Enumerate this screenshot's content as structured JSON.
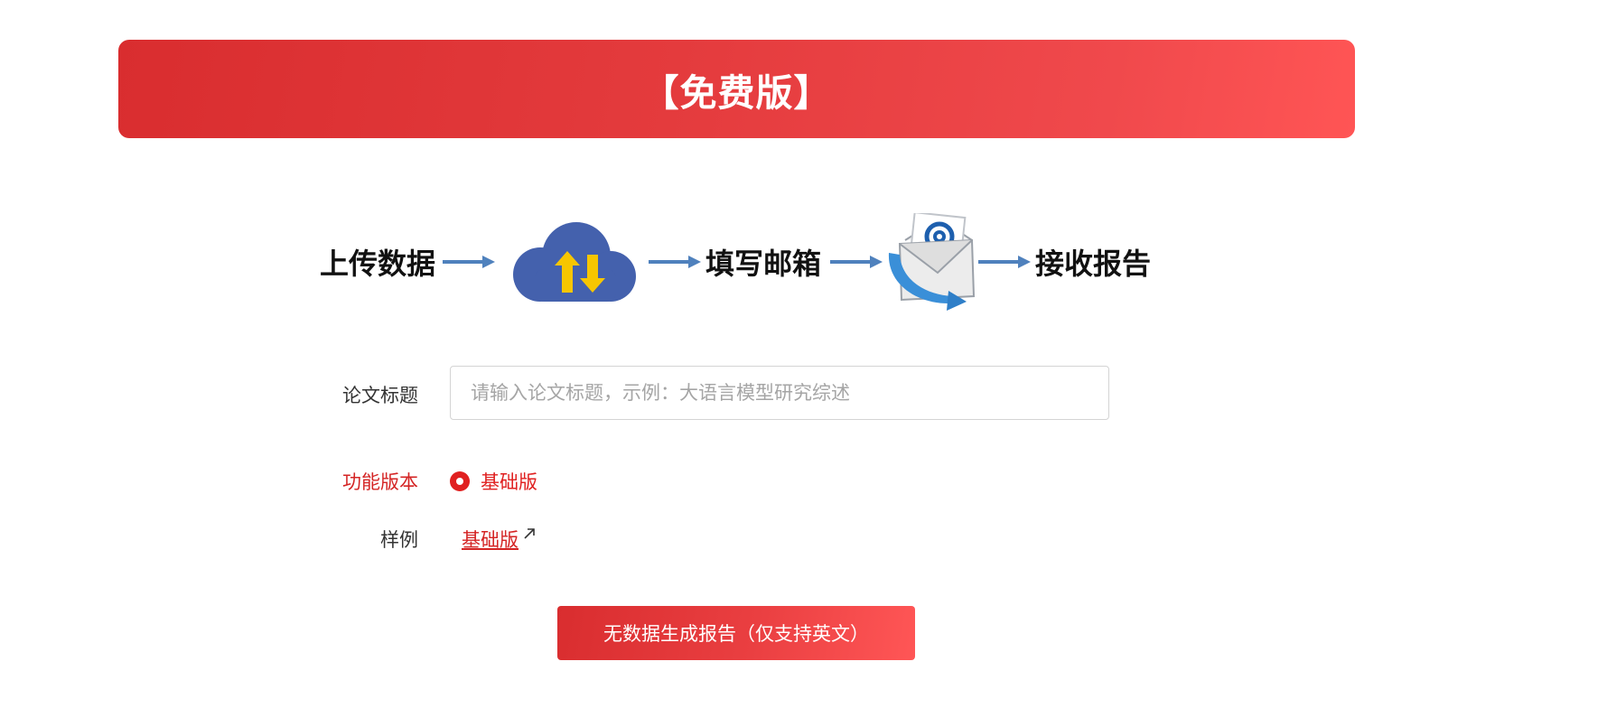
{
  "banner": {
    "title": "【免费版】"
  },
  "flow": {
    "steps": [
      "上传数据",
      "填写邮箱",
      "接收报告"
    ],
    "icons": [
      "cloud-upload-download-icon",
      "email-envelope-icon"
    ]
  },
  "form": {
    "title_label": "论文标题",
    "title_placeholder": "请输入论文标题，示例：大语言模型研究综述",
    "title_value": "",
    "version_label": "功能版本",
    "version_option": "基础版",
    "version_selected": true,
    "sample_label": "样例",
    "sample_link": "基础版"
  },
  "submit": {
    "label": "无数据生成报告（仅支持英文）"
  },
  "colors": {
    "accent": "#e02020",
    "banner_start": "#d92d2f",
    "banner_end": "#ff5555",
    "arrow": "#4f81bd",
    "cloud": "#4461ad",
    "cloud_arrows": "#f7c600"
  }
}
